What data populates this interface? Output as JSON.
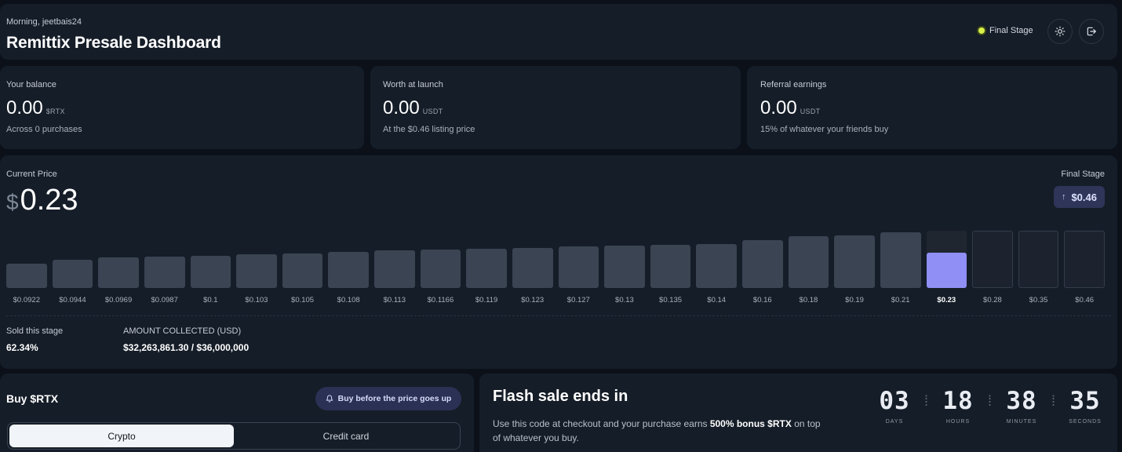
{
  "header": {
    "greeting": "Morning, jeetbais24",
    "title": "Remittix Presale Dashboard",
    "stage": "Final Stage",
    "stage_dot_color": "#d7f04a",
    "theme_icon": "sun-icon",
    "logout_icon": "logout-icon"
  },
  "stats": {
    "balance": {
      "label": "Your balance",
      "value": "0.00",
      "unit": "$RTX",
      "note": "Across 0 purchases"
    },
    "worth": {
      "label": "Worth at launch",
      "value": "0.00",
      "unit": "USDT",
      "note": "At the $0.46 listing price"
    },
    "referral": {
      "label": "Referral earnings",
      "value": "0.00",
      "unit": "USDT",
      "note": "15% of whatever your friends buy"
    }
  },
  "price": {
    "label": "Current Price",
    "currency": "$",
    "value": "0.23",
    "final_stage_label": "Final Stage",
    "final_stage_arrow": "↑",
    "final_stage_price": "$0.46",
    "sold_label": "Sold this stage",
    "sold_value": "62.34%",
    "amount_label": "AMOUNT COLLECTED (USD)",
    "amount_value": "$32,263,861.30 / $36,000,000",
    "current_fill": 0.6234
  },
  "chart_data": {
    "type": "bar",
    "categories": [
      "$0.0922",
      "$0.0944",
      "$0.0969",
      "$0.0987",
      "$0.1",
      "$0.103",
      "$0.105",
      "$0.108",
      "$0.113",
      "$0.1166",
      "$0.119",
      "$0.123",
      "$0.127",
      "$0.13",
      "$0.135",
      "$0.14",
      "$0.16",
      "$0.18",
      "$0.19",
      "$0.21",
      "$0.23",
      "$0.28",
      "$0.35",
      "$0.46"
    ],
    "values": [
      0.0922,
      0.0944,
      0.0969,
      0.0987,
      0.1,
      0.103,
      0.105,
      0.108,
      0.113,
      0.1166,
      0.119,
      0.123,
      0.127,
      0.13,
      0.135,
      0.14,
      0.16,
      0.18,
      0.19,
      0.21,
      0.23,
      0.28,
      0.35,
      0.46
    ],
    "current_index": 20,
    "colors": {
      "past": "#3a4452",
      "current": "#8f8ff5",
      "future": "#1c232e"
    }
  },
  "buy": {
    "title": "Buy $RTX",
    "badge": "Buy before the price goes up",
    "badge_icon": "bell-icon",
    "tabs": [
      "Crypto",
      "Credit card"
    ],
    "active_tab": "Crypto"
  },
  "flash": {
    "title": "Flash sale ends in",
    "desc_before": "Use this code at checkout and your purchase earns ",
    "desc_bold": "500% bonus $RTX",
    "desc_after": " on top of whatever you buy.",
    "countdown": [
      {
        "value": "03",
        "label": "DAYS"
      },
      {
        "value": "18",
        "label": "HOURS"
      },
      {
        "value": "38",
        "label": "MINUTES"
      },
      {
        "value": "35",
        "label": "SECONDS"
      }
    ]
  }
}
